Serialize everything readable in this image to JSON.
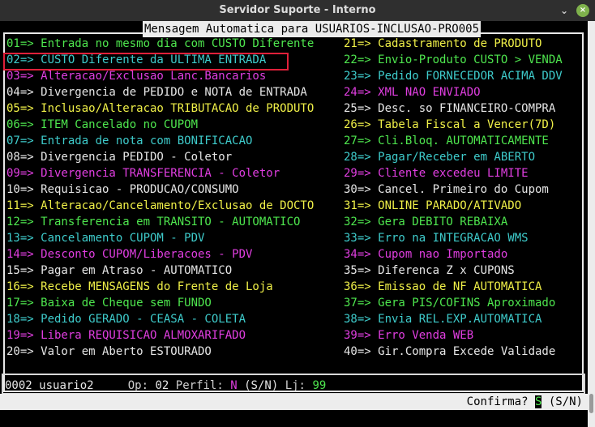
{
  "window": {
    "title": "Servidor Suporte - Interno",
    "minimize": "⌄",
    "close": "×"
  },
  "header": {
    "title": "Mensagem Automatica para USUARIOS-INCLUSAO-PRO005"
  },
  "left_items": [
    {
      "text": "01=> Entrada no mesmo dia com CUSTO Diferente",
      "color": "green"
    },
    {
      "text": "02=> CUSTO Diferente da ULTIMA ENTRADA",
      "color": "cyan"
    },
    {
      "text": "03=> Alteracao/Exclusao Lanc.Bancarios",
      "color": "mag"
    },
    {
      "text": "04=> Divergencia de PEDIDO e NOTA de ENTRADA",
      "color": "white"
    },
    {
      "text": "05=> Inclusao/Alteracao TRIBUTACAO de PRODUTO",
      "color": "yellow"
    },
    {
      "text": "06=> ITEM Cancelado no CUPOM",
      "color": "green"
    },
    {
      "text": "07=> Entrada de nota com BONIFICACAO",
      "color": "cyan"
    },
    {
      "text": "08=> Divergencia PEDIDO - Coletor",
      "color": "white"
    },
    {
      "text": "09=> Divergencia TRANSFERENCIA - Coletor",
      "color": "mag"
    },
    {
      "text": "10=> Requisicao - PRODUCAO/CONSUMO",
      "color": "white"
    },
    {
      "text": "11=> Alteracao/Cancelamento/Exclusao de DOCTO",
      "color": "yellow"
    },
    {
      "text": "12=> Transferencia em TRANSITO - AUTOMATICO",
      "color": "green"
    },
    {
      "text": "13=> Cancelamento CUPOM - PDV",
      "color": "cyan"
    },
    {
      "text": "14=> Desconto CUPOM/Liberacoes - PDV",
      "color": "mag"
    },
    {
      "text": "15=> Pagar em Atraso - AUTOMATICO",
      "color": "white"
    },
    {
      "text": "16=> Recebe MENSAGENS do Frente de Loja",
      "color": "yellow"
    },
    {
      "text": "17=> Baixa de Cheque sem FUNDO",
      "color": "green"
    },
    {
      "text": "18=> Pedido GERADO - CEASA - COLETA",
      "color": "cyan"
    },
    {
      "text": "19=> Libera REQUISICAO ALMOXARIFADO",
      "color": "mag"
    },
    {
      "text": "20=> Valor em Aberto ESTOURADO",
      "color": "white"
    }
  ],
  "right_items": [
    {
      "text": "21=> Cadastramento de PRODUTO",
      "color": "yellow"
    },
    {
      "text": "22=> Envio-Produto CUSTO > VENDA",
      "color": "green"
    },
    {
      "text": "23=> Pedido FORNECEDOR ACIMA DDV",
      "color": "cyan"
    },
    {
      "text": "24=> XML NAO ENVIADO",
      "color": "mag"
    },
    {
      "text": "25=> Desc. so FINANCEIRO-COMPRA",
      "color": "white"
    },
    {
      "text": "26=> Tabela Fiscal a Vencer(7D)",
      "color": "yellow"
    },
    {
      "text": "27=> Cli.Bloq. AUTOMATICAMENTE",
      "color": "green"
    },
    {
      "text": "28=> Pagar/Receber em ABERTO",
      "color": "cyan"
    },
    {
      "text": "29=> Cliente excedeu LIMITE",
      "color": "mag"
    },
    {
      "text": "30=> Cancel. Primeiro do Cupom",
      "color": "white"
    },
    {
      "text": "31=> ONLINE PARADO/ATIVADO",
      "color": "yellow"
    },
    {
      "text": "32=> Gera DEBITO REBAIXA",
      "color": "green"
    },
    {
      "text": "33=> Erro na INTEGRACAO WMS",
      "color": "cyan"
    },
    {
      "text": "34=> Cupom nao Importado",
      "color": "mag"
    },
    {
      "text": "35=> Diferenca Z x CUPONS",
      "color": "white"
    },
    {
      "text": "36=> Emissao de NF AUTOMATICA",
      "color": "yellow"
    },
    {
      "text": "37=> Gera PIS/COFINS Aproximado",
      "color": "green"
    },
    {
      "text": "38=> Envia REL.EXP.AUTOMATICA",
      "color": "cyan"
    },
    {
      "text": "39=> Erro Venda WEB",
      "color": "mag"
    },
    {
      "text": "40=> Gir.Compra Excede Validade",
      "color": "white"
    }
  ],
  "status": {
    "user_code": "0002",
    "user_name": "usuario2",
    "op_label": "Op:",
    "op_value": "02",
    "perfil_label": "Perfil:",
    "perfil_value": "N",
    "perfil_hint": "(S/N)",
    "lj_label": "Lj:",
    "lj_value": "99"
  },
  "confirm": {
    "label": "Confirma?",
    "value": "S",
    "hint": "(S/N)"
  },
  "colors": {
    "green": "#4ee64e",
    "cyan": "#3ecbcb",
    "magenta": "#e03ee0",
    "yellow": "#f0f048",
    "white": "#e6e6e6",
    "selection": "#e0203a"
  }
}
